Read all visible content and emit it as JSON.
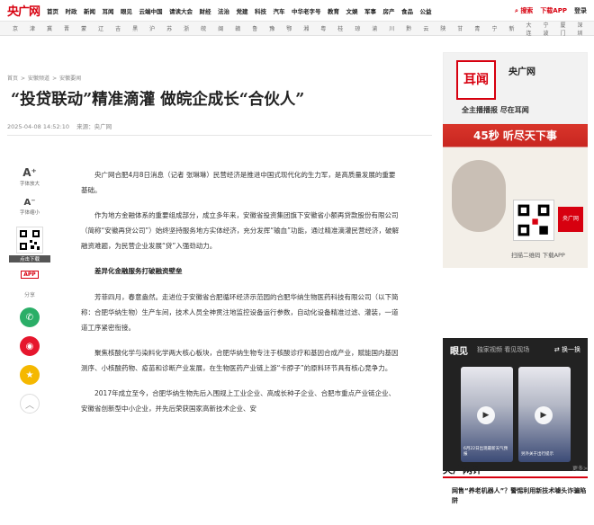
{
  "header": {
    "logo": "央广网",
    "nav": [
      "首页",
      "时政",
      "新闻",
      "耳闻",
      "眼见",
      "云端中国",
      "请读大会",
      "财经",
      "法治",
      "党建",
      "科技",
      "汽车",
      "中华老字号",
      "教育",
      "文娱",
      "军事",
      "房产",
      "食品",
      "公益"
    ],
    "search": "搜索",
    "download": "下载APP",
    "login": "登录"
  },
  "cities": [
    "京",
    "津",
    "冀",
    "晋",
    "蒙",
    "辽",
    "吉",
    "黑",
    "沪",
    "苏",
    "浙",
    "皖",
    "闽",
    "赣",
    "鲁",
    "豫",
    "鄂",
    "湘",
    "粤",
    "桂",
    "琼",
    "渝",
    "川",
    "黔",
    "云",
    "陕",
    "甘",
    "青",
    "宁",
    "新",
    "大连",
    "宁波",
    "厦门",
    "深圳"
  ],
  "breadcrumb": [
    "首页",
    ">",
    "安徽频道",
    ">",
    "安徽要闻"
  ],
  "article": {
    "title": "“投贷联动”精准滴灌 做皖企成长“合伙人”",
    "datetime": "2025-04-08 14:52:10",
    "source": "来源：央广网",
    "paragraphs": [
      "央广网合肥4月8日消息（记者 张琳琳）民营经济是推进中国式现代化的生力军，是高质量发展的重要基础。",
      "作为地方金融体系的重要组成部分，成立多年来，安徽省投资集团旗下安徽省小额再贷款股份有限公司（简称“安徽再贷公司”）始终坚持服务地方实体经济，充分发挥“输血”功能，通过精准滴灌民营经济，破解融资难题，为民营企业发展“贷”入强劲动力。"
    ],
    "subheading": "差异化金融服务打破融资壁垒",
    "paragraphs2": [
      "芳菲四月，春意盎然。走进位于安徽省合肥循环经济示范园的合肥华纳生物医药科技有限公司（以下简称：合肥华纳生物）生产车间，技术人员全神贯注地监控设备运行参数，自动化设备精准过滤、灌装，一道道工序紧密衔接。",
      "聚焦核酸化学与染料化学两大核心板块，合肥华纳生物专注于核酸诊疗和基因合成产业，赋能国内基因测序、小核酸药物、疫苗和诊断产业发展，在生物医药产业链上游“卡脖子”的原料环节具有核心竞争力。",
      "2017年成立至今，合肥华纳生物先后入围规上工业企业、高成长种子企业、合肥市重点产业链企业、安徽省创新型中小企业，并先后荣获国家高新技术企业、安"
    ]
  },
  "tools": {
    "font_up_label": "字体放大",
    "font_down_label": "字体缩小",
    "qr_label": "点击下载",
    "app_label": "APP",
    "share_label": "分享"
  },
  "sidebar": {
    "ad_top_brand": "耳闻",
    "ad_top_app": "央广网",
    "ad_top_slogan": "全主播播报 尽在耳闻",
    "ad_main_title": "45秒 听尽天下事",
    "ad_main_sub": "扫描二维码 下载APP",
    "video_title": "眼见",
    "video_sub": "独家视频 看见现场",
    "video_next": "换一换",
    "video_cards": [
      "6月22日出现最新天气预报",
      "另外关于出行提示"
    ],
    "comment_title": "央广网评",
    "comment_more": "更多>",
    "comment_item": "网售“养老机器人”？警惕利用新技术噱头诈骗陷阱"
  },
  "colors": {
    "brand_red": "#d7000f",
    "accent_red": "#c82620"
  }
}
